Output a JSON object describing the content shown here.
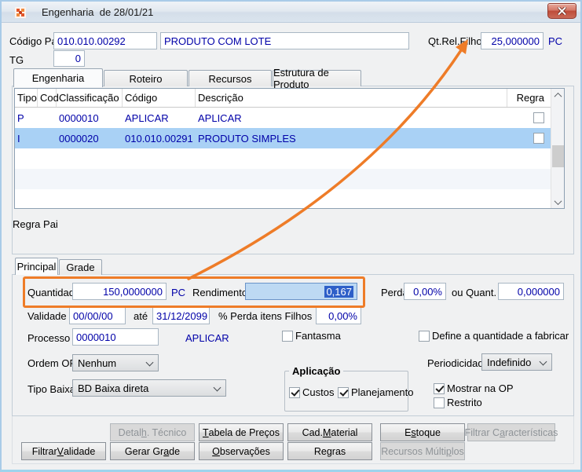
{
  "window": {
    "title": "Engenharia  de 28/01/21"
  },
  "colors": {
    "accent_orange": "#EE7C28",
    "value_navy": "#0000A8",
    "selection_blue": "#2E5FC8",
    "selected_row": "#A9D1F5"
  },
  "header": {
    "codigo_pai_label": "Código Pai",
    "codigo_pai_value": "010.010.00292",
    "descricao_value": "PRODUTO COM LOTE",
    "qt_rel_filho_label": "Qt.Rel.Filho",
    "qt_rel_filho_value": "25,000000",
    "qt_rel_filho_unit": "PC",
    "tg_label": "TG",
    "tg_value": "0"
  },
  "main_tabs": [
    {
      "label": "Engenharia",
      "selected": true
    },
    {
      "label": "Roteiro",
      "selected": false
    },
    {
      "label": "Recursos",
      "selected": false
    },
    {
      "label": "Estrutura de Produto",
      "selected": false
    }
  ],
  "table": {
    "columns": [
      "Tipo",
      "Cod",
      "Classificação",
      "Código",
      "Descrição",
      "Regra"
    ],
    "rows": [
      {
        "tipo": "P",
        "cod": "",
        "classificacao": "0000010",
        "codigo": "APLICAR",
        "descricao": "APLICAR",
        "regra": false,
        "selected": false
      },
      {
        "tipo": "I",
        "cod": "",
        "classificacao": "0000020",
        "codigo": "010.010.00291",
        "descricao": "PRODUTO SIMPLES",
        "regra": false,
        "selected": true
      }
    ]
  },
  "regra_pai_label": "Regra Pai",
  "sub_tabs": [
    {
      "label": "Principal",
      "selected": true
    },
    {
      "label": "Grade",
      "selected": false
    }
  ],
  "principal": {
    "quantidade_label": "Quantidade",
    "quantidade_value": "150,0000000",
    "quantidade_unit": "PC",
    "rendimento_label": "Rendimento",
    "rendimento_value": "0,167",
    "perda_label": "Perda",
    "perda_value": "0,00%",
    "ou_quant_label": "ou Quant.",
    "ou_quant_value": "0,000000",
    "validade_label": "Validade",
    "validade_value": "00/00/00",
    "ate_label": "até",
    "ate_value": "31/12/2099",
    "perda_filhos_label": "% Perda itens Filhos",
    "perda_filhos_value": "0,00%",
    "processo_label": "Processo",
    "processo_value": "0000010",
    "processo_desc": "APLICAR",
    "fantasma_label": "Fantasma",
    "fantasma_checked": false,
    "define_label": "Define a quantidade a fabricar",
    "define_checked": false,
    "ordem_op_label": "Ordem OP",
    "ordem_op_value": "Nenhum",
    "periodicidade_label": "Periodicidade",
    "periodicidade_value": "Indefinido",
    "tipo_baixa_label": "Tipo Baixa",
    "tipo_baixa_value": "BD Baixa direta",
    "aplicacao_label": "Aplicação",
    "custos_label": "Custos",
    "custos_checked": true,
    "planejamento_label": "Planejamento",
    "planejamento_checked": true,
    "mostrar_op_label": "Mostrar na OP",
    "mostrar_op_checked": true,
    "restrito_label": "Restrito",
    "restrito_checked": false
  },
  "buttons": {
    "row1": [
      {
        "pre": "Detal",
        "key": "h",
        "post": ". Técnico",
        "disabled": true
      },
      {
        "pre": "",
        "key": "T",
        "post": "abela de Preços",
        "disabled": false
      },
      {
        "pre": "Cad. ",
        "key": "M",
        "post": "aterial",
        "disabled": false
      },
      {
        "pre": "E",
        "key": "s",
        "post": "toque",
        "disabled": false
      },
      {
        "pre": "Filtrar C",
        "key": "a",
        "post": "racterísticas",
        "disabled": true
      }
    ],
    "row2": [
      {
        "pre": "Filtrar ",
        "key": "V",
        "post": "alidade",
        "disabled": false
      },
      {
        "pre": "Gerar Gr",
        "key": "a",
        "post": "de",
        "disabled": false
      },
      {
        "pre": "",
        "key": "O",
        "post": "bservações",
        "disabled": false
      },
      {
        "pre": "Re",
        "key": "g",
        "post": "ras",
        "disabled": false
      },
      {
        "pre": "Recursos Múlti",
        "key": "p",
        "post": "los",
        "disabled": true
      }
    ]
  }
}
